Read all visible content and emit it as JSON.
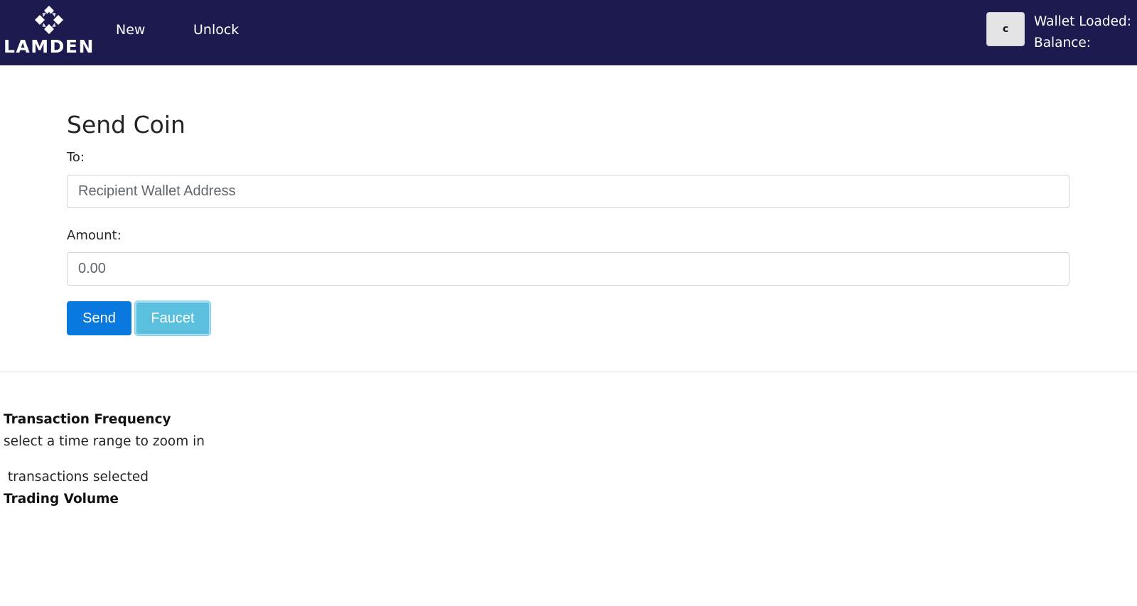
{
  "brand": {
    "name": "LAMDEN",
    "logo_icon": "lamden-diamond-logo"
  },
  "nav": {
    "items": [
      {
        "label": "New"
      },
      {
        "label": "Unlock"
      }
    ]
  },
  "wallet": {
    "refresh_symbol": "c",
    "loaded_label": "Wallet Loaded:",
    "balance_label": "Balance:"
  },
  "send_form": {
    "title": "Send Coin",
    "to_label": "To:",
    "to_placeholder": "Recipient Wallet Address",
    "amount_label": "Amount:",
    "amount_placeholder": "0.00",
    "send_label": "Send",
    "faucet_label": "Faucet"
  },
  "stats": {
    "transaction_frequency_title": "Transaction Frequency",
    "transaction_frequency_hint": "select a time range to zoom in",
    "transactions_selected_text": " transactions selected",
    "trading_volume_title": "Trading Volume"
  },
  "colors": {
    "navbar": "#1c1a4f",
    "send_button": "#0a79df",
    "faucet_button": "#5bc0de"
  }
}
